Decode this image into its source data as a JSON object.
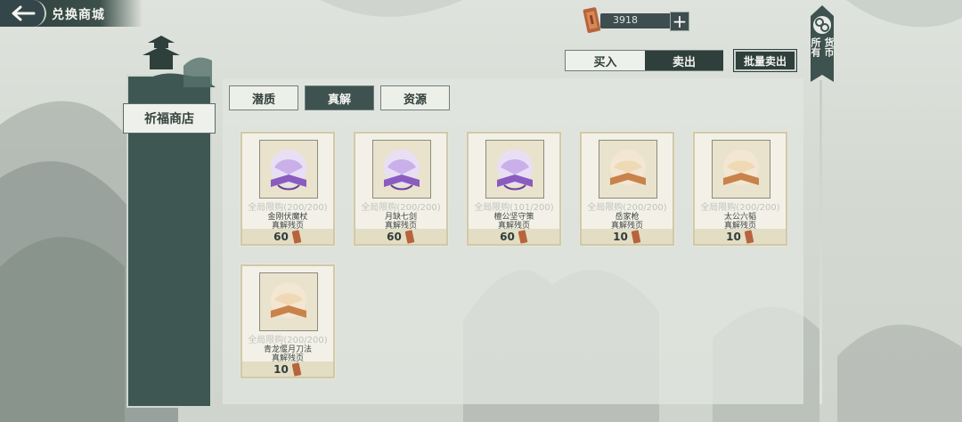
{
  "header": {
    "title": "兑换商城"
  },
  "currency": {
    "amount": "3918",
    "plus": "+"
  },
  "trade_mode": {
    "buy_label": "买入",
    "sell_label": "卖出",
    "bulk_sell_label": "批量卖出"
  },
  "currency_filter": {
    "chars": [
      "所有",
      "货币"
    ]
  },
  "shop": {
    "name": "祈福商店"
  },
  "categories": [
    {
      "label": "潜质",
      "active": false
    },
    {
      "label": "真解",
      "active": true
    },
    {
      "label": "资源",
      "active": false
    }
  ],
  "items": [
    {
      "limit": "全局限购(200/200)",
      "name": "金刚伏魔杖",
      "sub": "真解残页",
      "price": "60",
      "tier": "purple"
    },
    {
      "limit": "全局限购(200/200)",
      "name": "月缺七剑",
      "sub": "真解残页",
      "price": "60",
      "tier": "purple"
    },
    {
      "limit": "全局限购(101/200)",
      "name": "檀公坚守策",
      "sub": "真解残页",
      "price": "60",
      "tier": "purple"
    },
    {
      "limit": "全局限购(200/200)",
      "name": "岳家枪",
      "sub": "真解残页",
      "price": "10",
      "tier": "orange"
    },
    {
      "limit": "全局限购(200/200)",
      "name": "太公六韬",
      "sub": "真解残页",
      "price": "10",
      "tier": "orange"
    },
    {
      "limit": "全局限购(200/200)",
      "name": "青龙偃月刀法",
      "sub": "真解残页",
      "price": "10",
      "tier": "orange"
    }
  ],
  "colors": {
    "purple": "#8a5cc0",
    "orange": "#c9824a",
    "panel": "#3f5752"
  }
}
